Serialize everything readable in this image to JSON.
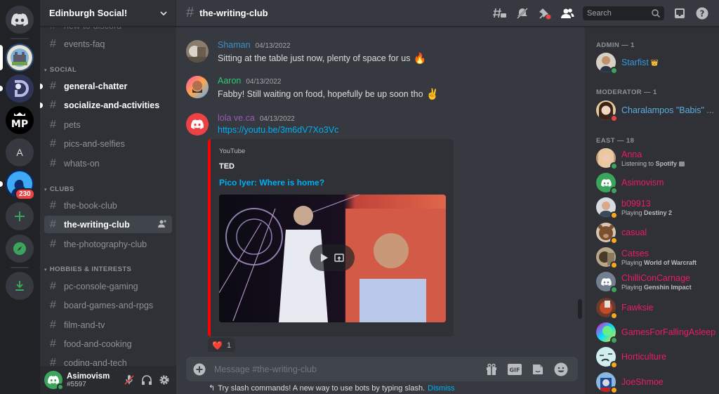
{
  "server_rail": {
    "home_label": "Direct Messages",
    "servers": [
      {
        "name": "Edinburgh Social!",
        "initials": "",
        "active": true
      },
      {
        "name": "D server",
        "initials": "D"
      },
      {
        "name": "MP server",
        "initials": "MP"
      },
      {
        "name": "A server",
        "initials": "A"
      },
      {
        "name": "Silhouette server",
        "initials": "",
        "badge": "230"
      }
    ],
    "add_server_label": "Add a Server",
    "explore_label": "Explore Public Servers",
    "download_label": "Download Apps"
  },
  "guild": {
    "name": "Edinburgh Social!",
    "top_partial_channel": "new-to-discord",
    "channels_top": [
      "events-faq"
    ],
    "categories": [
      {
        "name": "SOCIAL",
        "channels": [
          {
            "name": "general-chatter",
            "unread": true
          },
          {
            "name": "socialize-and-activities",
            "unread": true
          },
          {
            "name": "pets"
          },
          {
            "name": "pics-and-selfies"
          },
          {
            "name": "whats-on"
          }
        ]
      },
      {
        "name": "CLUBS",
        "channels": [
          {
            "name": "the-book-club"
          },
          {
            "name": "the-writing-club",
            "active": true
          },
          {
            "name": "the-photography-club"
          }
        ]
      },
      {
        "name": "HOBBIES & INTERESTS",
        "channels": [
          {
            "name": "pc-console-gaming"
          },
          {
            "name": "board-games-and-rpgs"
          },
          {
            "name": "film-and-tv"
          },
          {
            "name": "food-and-cooking"
          },
          {
            "name": "coding-and-tech"
          }
        ]
      }
    ]
  },
  "user": {
    "name": "Asimovism",
    "tag": "#5597"
  },
  "channel": {
    "name": "the-writing-club",
    "search_placeholder": "Search",
    "composer_placeholder": "Message #the-writing-club"
  },
  "messages": [
    {
      "author": "Shaman",
      "color": "#3c8fc7",
      "timestamp": "04/13/2022",
      "text": "Sitting at the table just now, plenty of space for us",
      "emoji": "🔥"
    },
    {
      "author": "Aaron",
      "color": "#2ecc71",
      "timestamp": "04/13/2022",
      "text": "Fabby! Still waiting on food, hopefully be up soon tho",
      "emoji": "✌️"
    },
    {
      "author": "lola ve.ca",
      "color": "#9b59b6",
      "timestamp": "04/13/2022",
      "link": "https://youtu.be/3m6dV7Xo3Vc",
      "embed": {
        "provider": "YouTube",
        "author": "TED",
        "title": "Pico Iyer: Where is home?"
      },
      "reaction": {
        "emoji": "❤️",
        "count": "1"
      }
    }
  ],
  "tip": {
    "text": "Try slash commands! A new way to use bots by typing slash.",
    "dismiss": "Dismiss"
  },
  "members": {
    "groups": [
      {
        "label": "ADMIN — 1",
        "members": [
          {
            "name": "Starfist",
            "color": "#3498db",
            "status": "online",
            "crown": "👑"
          }
        ]
      },
      {
        "label": "MODERATOR — 1",
        "members": [
          {
            "name": "Charalampos \"Babis\" ...",
            "color": "#5dade2",
            "status": "dnd"
          }
        ]
      },
      {
        "label": "EAST — 18",
        "members": [
          {
            "name": "Anna",
            "color": "#e91e63",
            "status": "online",
            "activity_prefix": "Listening to",
            "activity": "Spotify"
          },
          {
            "name": "Asimovism",
            "color": "#e91e63",
            "status": "online"
          },
          {
            "name": "b09913",
            "color": "#e91e63",
            "status": "idle",
            "activity_prefix": "Playing",
            "activity": "Destiny 2"
          },
          {
            "name": "casual",
            "color": "#e91e63",
            "status": "idle"
          },
          {
            "name": "Catses",
            "color": "#e91e63",
            "status": "idle",
            "activity_prefix": "Playing",
            "activity": "World of Warcraft"
          },
          {
            "name": "ChilliConCarnage",
            "color": "#e91e63",
            "status": "online",
            "activity_prefix": "Playing",
            "activity": "Genshin Impact"
          },
          {
            "name": "Fawksie",
            "color": "#e91e63",
            "status": "idle"
          },
          {
            "name": "GamesForFallingAsleep",
            "color": "#e91e63",
            "status": "online"
          },
          {
            "name": "Horticulture",
            "color": "#e91e63",
            "status": "idle"
          },
          {
            "name": "JoeShmoe",
            "color": "#e91e63",
            "status": "idle"
          }
        ]
      }
    ]
  }
}
